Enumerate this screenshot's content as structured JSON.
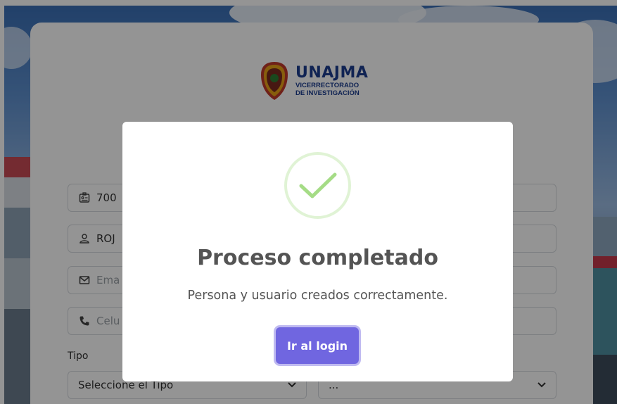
{
  "logo": {
    "title": "UNAJMA",
    "subtitle_1": "VICERRECTORADO",
    "subtitle_2": "DE INVESTIGACIÓN"
  },
  "form": {
    "dni_value": "700",
    "name_value": "ROJ",
    "email_placeholder": "Ema",
    "phone_placeholder": "Celu",
    "tipo_label": "Tipo",
    "tipo_select_value": "Seleccione el Tipo",
    "second_select_value": "..."
  },
  "modal": {
    "title": "Proceso completado",
    "message": "Persona y usuario creados correctamente.",
    "button_label": "Ir al login",
    "icon": "success-check-icon"
  },
  "colors": {
    "confirm_button": "#7066e0",
    "success_green": "#a5dc86",
    "logo_blue": "#1c3d8f"
  }
}
